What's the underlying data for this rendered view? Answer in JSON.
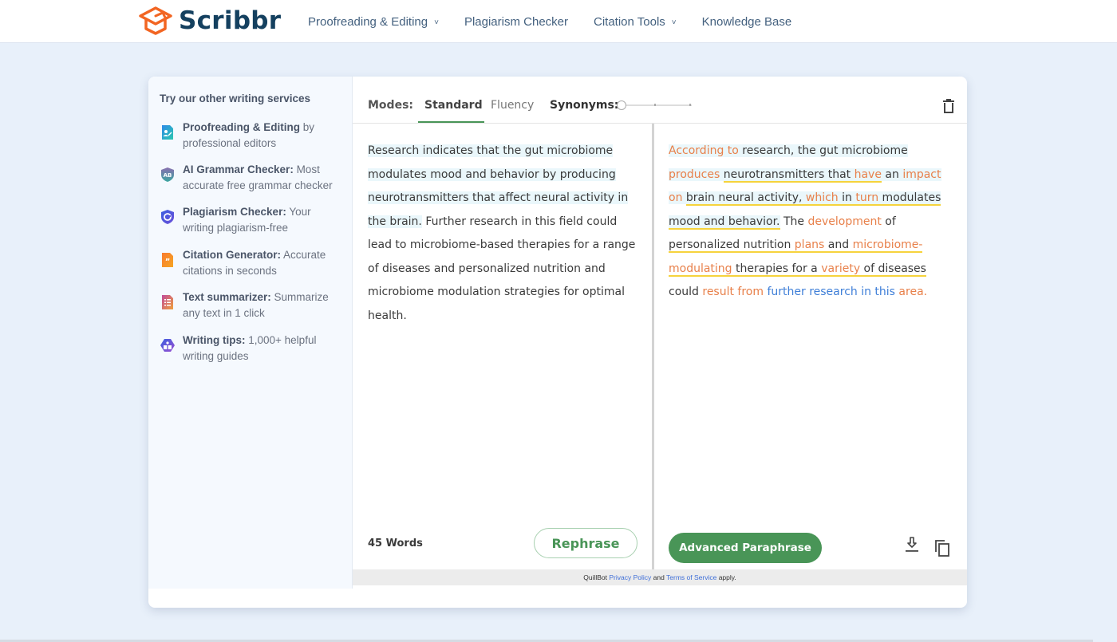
{
  "header": {
    "brand": "Scribbr",
    "nav": [
      {
        "label": "Proofreading & Editing",
        "has_dropdown": true
      },
      {
        "label": "Plagiarism Checker",
        "has_dropdown": false
      },
      {
        "label": "Citation Tools",
        "has_dropdown": true
      },
      {
        "label": "Knowledge Base",
        "has_dropdown": false
      }
    ],
    "chevron": "⌄"
  },
  "sidebar": {
    "title": "Try our other writing services",
    "items": [
      {
        "icon": "proofreading-icon",
        "title": "Proofreading & Editing",
        "desc": " by professional editors"
      },
      {
        "icon": "grammar-checker-icon",
        "title": "AI Grammar Checker:",
        "desc": " Most accurate free grammar checker"
      },
      {
        "icon": "plagiarism-checker-icon",
        "title": "Plagiarism Checker:",
        "desc": " Your writing plagiarism-free"
      },
      {
        "icon": "citation-generator-icon",
        "title": "Citation Generator:",
        "desc": " Accurate citations in seconds"
      },
      {
        "icon": "text-summarizer-icon",
        "title": "Text summarizer:",
        "desc": " Summarize any text in 1 click"
      },
      {
        "icon": "writing-tips-icon",
        "title": "Writing tips:",
        "desc": " 1,000+ helpful writing guides"
      }
    ]
  },
  "tool": {
    "modes_label": "Modes:",
    "modes": [
      {
        "label": "Standard",
        "active": true
      },
      {
        "label": "Fluency",
        "active": false
      }
    ],
    "synonyms_label": "Synonyms:",
    "synonyms_level": 0,
    "input": {
      "highlighted": "Research indicates that the gut microbiome modulates mood and behavior by producing neurotransmitters that affect neural activity in the brain.",
      "rest": " Further research in this field could lead to microbiome-based therapies for a range of diseases and personalized nutrition and microbiome modulation strategies for optimal health.",
      "word_count": "45 Words"
    },
    "rephrase_label": "Rephrase",
    "output": {
      "segments": [
        {
          "t": "According to",
          "c": "changed",
          "hl": true
        },
        {
          "t": " research, the gut microbiome",
          "c": "plain",
          "hl": true
        },
        {
          "t": " ",
          "c": "plain"
        },
        {
          "t": "produces",
          "c": "changed",
          "hl": true
        },
        {
          "t": " ",
          "c": "plain",
          "hl": true
        },
        {
          "t": "neurotransmitters that ",
          "c": "plain",
          "hl": true,
          "ul": true
        },
        {
          "t": "have",
          "c": "changed",
          "hl": true,
          "ul": true
        },
        {
          "t": " an ",
          "c": "plain",
          "hl": true
        },
        {
          "t": "impact",
          "c": "changed",
          "hl": true
        },
        {
          "t": " ",
          "c": "plain"
        },
        {
          "t": "on",
          "c": "changed",
          "hl": true
        },
        {
          "t": " ",
          "c": "plain",
          "hl": true
        },
        {
          "t": "brain neural activity, ",
          "c": "plain",
          "hl": true,
          "ul": true
        },
        {
          "t": "which",
          "c": "changed",
          "hl": true,
          "ul": true
        },
        {
          "t": " in ",
          "c": "plain",
          "hl": true,
          "ul": true
        },
        {
          "t": "turn",
          "c": "changed",
          "hl": true,
          "ul": true
        },
        {
          "t": " modulates",
          "c": "plain",
          "hl": true,
          "ul": true
        },
        {
          "t": " ",
          "c": "plain"
        },
        {
          "t": "mood and behavior.",
          "c": "plain",
          "hl": true,
          "ul": true
        },
        {
          "t": " The ",
          "c": "plain"
        },
        {
          "t": "development",
          "c": "changed"
        },
        {
          "t": " of ",
          "c": "plain"
        },
        {
          "t": "personalized nutrition ",
          "c": "plain",
          "ul": true
        },
        {
          "t": "plans",
          "c": "changed",
          "ul": true
        },
        {
          "t": " and ",
          "c": "plain",
          "ul": true
        },
        {
          "t": "microbiome-",
          "c": "changed",
          "ul": true
        },
        {
          "t": " ",
          "c": "plain"
        },
        {
          "t": "modulating",
          "c": "changed",
          "ul": true
        },
        {
          "t": " therapies for a ",
          "c": "plain",
          "ul": true
        },
        {
          "t": "variety",
          "c": "changed",
          "ul": true
        },
        {
          "t": " of diseases",
          "c": "plain",
          "ul": true
        },
        {
          "t": " could ",
          "c": "plain"
        },
        {
          "t": "result from",
          "c": "changed"
        },
        {
          "t": " further research in this",
          "c": "structural"
        },
        {
          "t": " area.",
          "c": "changed"
        }
      ]
    },
    "advanced_label": "Advanced Paraphrase",
    "legal": {
      "prefix": "QuillBot ",
      "privacy": "Privacy Policy",
      "and": " and ",
      "terms": "Terms of Service",
      "suffix": " apply."
    },
    "colors": {
      "accent_green": "#499557",
      "changed_word": "#e8804a",
      "structural_change": "#3f7fd8",
      "underline": "#f6d33c",
      "brand_orange": "#f26522",
      "brand_navy": "#14405f"
    }
  }
}
